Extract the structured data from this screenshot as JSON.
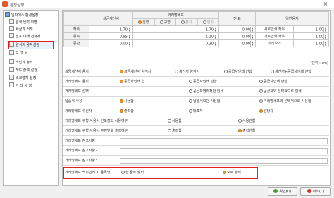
{
  "window": {
    "title": "환경설정",
    "close": "×"
  },
  "tree": {
    "items": [
      {
        "label": "일마에스 환경설정"
      },
      {
        "label": "검색 입력 화면"
      },
      {
        "label": "세금과 거래"
      },
      {
        "label": "전표 미래 견적서"
      },
      {
        "label": "양식지 용지설정"
      },
      {
        "label": "보 고 서"
      },
      {
        "label": "백업과 출력"
      },
      {
        "label": "제도 출력 설정"
      },
      {
        "label": "스크랩체 설정"
      },
      {
        "label": "기 타 사 항"
      }
    ]
  },
  "grid": {
    "h_tax": "세금계산서",
    "h_trade": "거래명세표",
    "h_voucher": "전 표",
    "h_general": "일반용지",
    "sub": [
      {
        "label": "신형",
        "on": true
      },
      {
        "label": "구형",
        "on": false
      },
      {
        "label": "봉지",
        "on": false
      },
      {
        "label": "연지",
        "on": false
      }
    ],
    "rows": [
      {
        "label": "좌측",
        "tax": "1.70",
        "trade": "1.70",
        "voucher": "0.00",
        "g1": "세로인쇄 좌우",
        "g2": "1.00"
      },
      {
        "label": "위측",
        "tax": "0.85",
        "trade": "1.10",
        "voucher": "0.00",
        "g1": "가로인쇄 좌우",
        "g2": "1.00"
      },
      {
        "label": "중간",
        "tax": "0.00",
        "trade": "0.30",
        "voucher": "0.00",
        "g1": "미리보기",
        "g2": "1.00"
      }
    ]
  },
  "unit": "(단위 : cm)",
  "settings": [
    {
      "label": "세금계산서 용지",
      "opts": [
        {
          "t": "세금계산서 양식지",
          "on": true
        },
        {
          "t": "계산서 양식지",
          "on": false
        },
        {
          "t": "공급자인쇄 안함",
          "on": false
        },
        {
          "t": "계산서+공급자인쇄 안함",
          "on": false
        }
      ]
    },
    {
      "label": "거래명세표 용지",
      "opts": [
        {
          "t": "공급자인쇄 함",
          "on": true
        },
        {
          "t": "공급자인쇄 안함",
          "on": false
        },
        {
          "t": "공급자인쇄 안함",
          "on": false
        }
      ]
    },
    {
      "label": "거래명세표 선택",
      "opts": [
        {
          "t": "공급자연락처만 인쇄",
          "on": false
        },
        {
          "t": "공급자와 선택적으로 인쇄",
          "on": false
        }
      ]
    },
    {
      "label": "납품서 사용",
      "opts": [
        {
          "t": "사용함",
          "on": true
        },
        {
          "t": "납품서보단 사용함",
          "on": false
        },
        {
          "t": "거래명세표와 선택적으로 사용함",
          "on": false
        }
      ]
    },
    {
      "label": "거래명세표 수신자",
      "opts": [
        {
          "t": "출력함",
          "on": true
        },
        {
          "t": "대표자",
          "on": false
        },
        {
          "t": "담당자",
          "on": true
        }
      ]
    },
    {
      "label": "거래명세표 구형 사용시 인도장소 사용여부",
      "opts": [
        {
          "t": "사용함",
          "on": false
        },
        {
          "t": "사용안함",
          "on": false
        }
      ]
    },
    {
      "label": "거래명세표 구형 사용시 주민번호 출력여부",
      "opts": [
        {
          "t": "출력함",
          "on": false
        },
        {
          "t": "출력안함",
          "on": true
        }
      ]
    }
  ],
  "notes": [
    {
      "label": "거래명세표 참고사항"
    },
    {
      "label": "거래명세표 참고사항2"
    },
    {
      "label": "거래명세표 참고사항3"
    }
  ],
  "last_setting": {
    "label": "거래명세표 백지인쇄 시 용목명",
    "opt1": "한 줄로 출력",
    "opt2": "모두 출력"
  },
  "buttons": {
    "ok": "확인(O)",
    "cancel": "취소(C)"
  },
  "colors": {
    "accent": "#f0a020",
    "highlight": "#e02020"
  }
}
